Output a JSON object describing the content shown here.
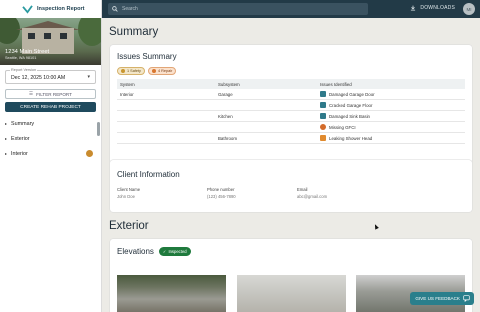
{
  "app": {
    "title": "Inspection Report"
  },
  "property": {
    "address_line1": "1234 Main Street",
    "address_line2": "Seattle, WA 98101"
  },
  "report_version": {
    "label": "Report Version",
    "value": "Dec 12, 2025 10:00 AM"
  },
  "sidebar": {
    "filter_label": "FILTER REPORT",
    "rehab_label": "CREATE REHAB PROJECT",
    "nav": [
      {
        "label": "Summary",
        "badge": false
      },
      {
        "label": "Exterior",
        "badge": false
      },
      {
        "label": "Interior",
        "badge": true
      }
    ]
  },
  "topbar": {
    "search_placeholder": "Search",
    "downloads_label": "DOWNLOADS",
    "avatar_initials": "MI"
  },
  "summary": {
    "heading": "Summary",
    "issues": {
      "title": "Issues Summary",
      "chips": [
        {
          "label": "1 Safety",
          "icon": "warning-icon",
          "color": "#c9962f"
        },
        {
          "label": "4 Repair",
          "icon": "wrench-icon",
          "color": "#d9762e"
        }
      ],
      "columns": [
        "System",
        "Subsystem",
        "Issues Identified"
      ],
      "rows": [
        {
          "system": "Interior",
          "subsystem": "Garage",
          "issue": "Damaged Garage Door",
          "icon": "garage-icon",
          "color": "#2f7a8a"
        },
        {
          "system": "",
          "subsystem": "",
          "issue": "Cracked Garage Floor",
          "icon": "garage-icon",
          "color": "#2f7a8a"
        },
        {
          "system": "",
          "subsystem": "Kitchen",
          "issue": "Damaged Sink Basin",
          "icon": "sink-icon",
          "color": "#2f7a8a"
        },
        {
          "system": "",
          "subsystem": "",
          "issue": "Missing GFCI",
          "icon": "warning-icon",
          "color": "#d36b2a"
        },
        {
          "system": "",
          "subsystem": "Bathroom",
          "issue": "Leaking Shower Head",
          "icon": "shower-icon",
          "color": "#e08a2e"
        }
      ]
    },
    "client": {
      "title": "Client Information",
      "fields": [
        {
          "label": "Client Name",
          "value": "John Doe"
        },
        {
          "label": "Phone number",
          "value": "(123) 456-7890"
        },
        {
          "label": "Email",
          "value": "abc@gmail.com"
        }
      ]
    }
  },
  "exterior": {
    "heading": "Exterior",
    "elevations": {
      "title": "Elevations",
      "status": "Inspected"
    }
  },
  "feedback_label": "GIVE US FEEDBACK"
}
